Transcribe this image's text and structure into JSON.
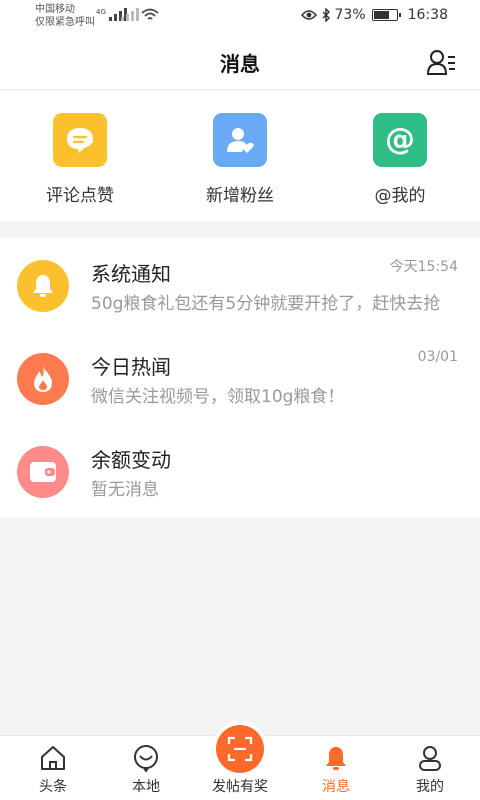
{
  "status_bar": {
    "carrier_line1": "中国移动",
    "carrier_line2": "仅限紧急呼叫",
    "network": "4G",
    "battery": "73%",
    "battery_level": 0.73,
    "time": "16:38"
  },
  "header": {
    "title": "消息"
  },
  "quick_actions": [
    {
      "label": "评论点赞",
      "icon": "comment-icon",
      "color": "#fbc02d"
    },
    {
      "label": "新增粉丝",
      "icon": "new-fans-icon",
      "color": "#6aa9f5"
    },
    {
      "label": "@我的",
      "icon": "at-icon",
      "color": "#2ebd85"
    }
  ],
  "messages": [
    {
      "title": "系统通知",
      "subtitle": "50g粮食礼包还有5分钟就要开抢了，赶快去抢",
      "time": "今天15:54",
      "icon": "bell-icon",
      "color": "#fbc02d"
    },
    {
      "title": "今日热闻",
      "subtitle": "微信关注视频号，领取10g粮食！",
      "time": "03/01",
      "icon": "flame-icon",
      "color": "#ff7b4f"
    },
    {
      "title": "余额变动",
      "subtitle": "暂无消息",
      "time": "",
      "icon": "wallet-icon",
      "color": "#ff8a8a"
    }
  ],
  "tabbar": {
    "items": [
      {
        "label": "头条",
        "icon": "home-icon"
      },
      {
        "label": "本地",
        "icon": "local-icon"
      },
      {
        "label": "发帖有奖",
        "icon": "scan-icon"
      },
      {
        "label": "消息",
        "icon": "bell-icon"
      },
      {
        "label": "我的",
        "icon": "profile-icon"
      }
    ],
    "active": "消息",
    "accent": "#ff6a2b"
  }
}
